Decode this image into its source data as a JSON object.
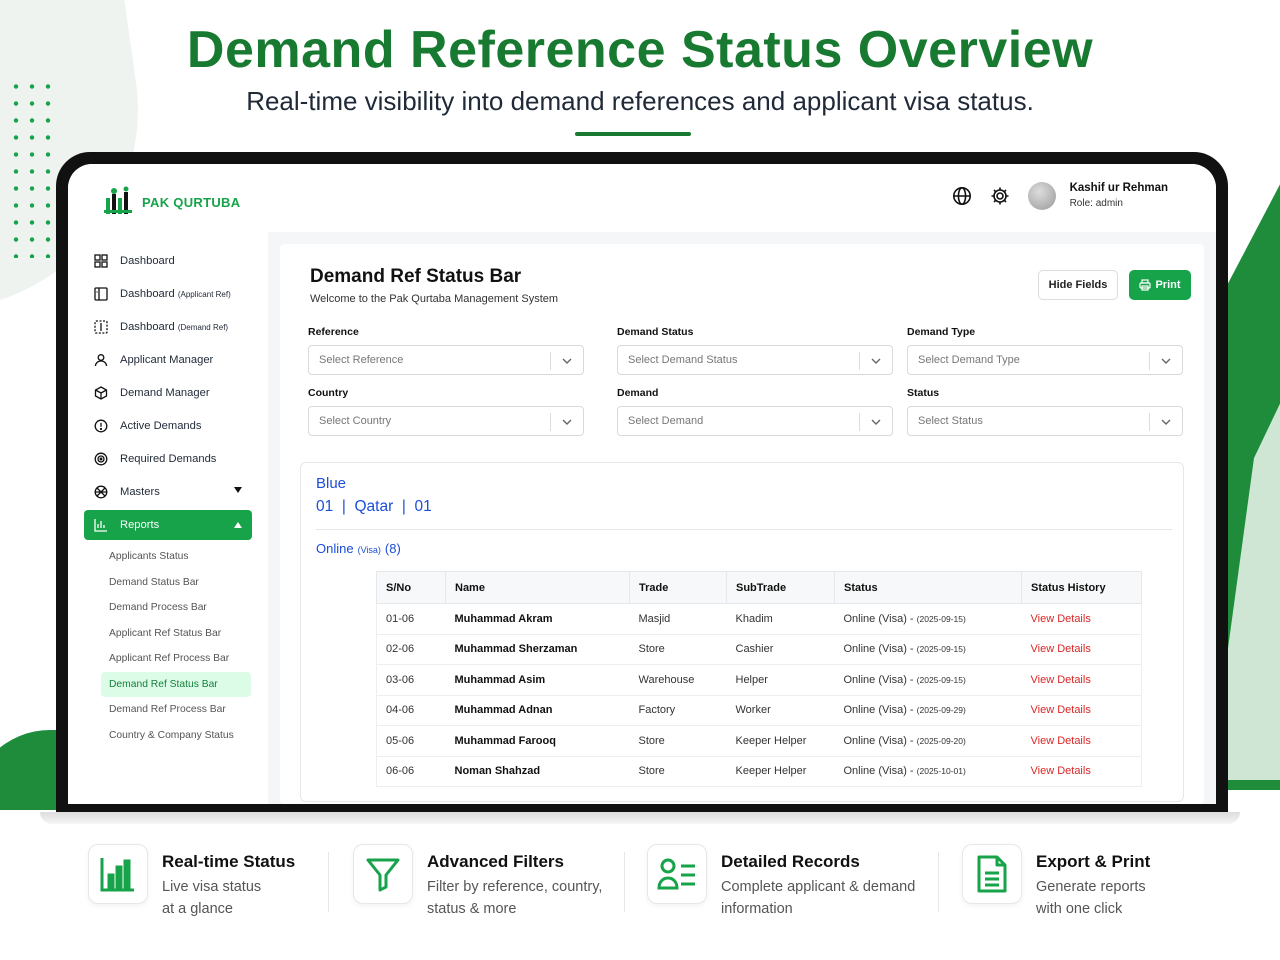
{
  "hero": {
    "title": "Demand Reference Status Overview",
    "subtitle": "Real-time visibility into demand references and applicant visa status."
  },
  "app": {
    "brand": "PAK QURTUBA",
    "user_name": "Kashif ur Rehman",
    "user_role": "Role: admin"
  },
  "colors": {
    "brand_green": "#16a34a",
    "link_blue": "#1d4ed8",
    "link_red": "#dc2626"
  },
  "sidebar": {
    "items": [
      {
        "label": "Dashboard",
        "suffix": "",
        "icon": "grid-icon"
      },
      {
        "label": "Dashboard",
        "suffix": "(Applicant Ref)",
        "icon": "panel-icon"
      },
      {
        "label": "Dashboard",
        "suffix": "(Demand Ref)",
        "icon": "panel-dashed-icon"
      },
      {
        "label": "Applicant Manager",
        "suffix": "",
        "icon": "user-icon"
      },
      {
        "label": "Demand Manager",
        "suffix": "",
        "icon": "cube-icon"
      },
      {
        "label": "Active Demands",
        "suffix": "",
        "icon": "alert-circle-icon"
      },
      {
        "label": "Required Demands",
        "suffix": "",
        "icon": "target-icon"
      },
      {
        "label": "Masters",
        "suffix": "",
        "icon": "globe-grid-icon"
      },
      {
        "label": "Reports",
        "suffix": "",
        "icon": "bar-chart-icon"
      }
    ],
    "sub_items": [
      "Applicants Status",
      "Demand Status Bar",
      "Demand Process Bar",
      "Applicant Ref Status Bar",
      "Applicant Ref Process Bar",
      "Demand Ref Status Bar",
      "Demand Ref Process Bar",
      "Country & Company Status"
    ],
    "active_sub": "Demand Ref Status Bar"
  },
  "page": {
    "title": "Demand Ref Status Bar",
    "subtitle": "Welcome to the Pak Qurtaba Management System",
    "hide_fields": "Hide Fields",
    "print": "Print"
  },
  "filters": [
    {
      "label": "Reference",
      "placeholder": "Select Reference"
    },
    {
      "label": "Demand Status",
      "placeholder": "Select Demand Status"
    },
    {
      "label": "Demand Type",
      "placeholder": "Select Demand Type"
    },
    {
      "label": "Country",
      "placeholder": "Select Country"
    },
    {
      "label": "Demand",
      "placeholder": "Select Demand"
    },
    {
      "label": "Status",
      "placeholder": "Select Status"
    }
  ],
  "card": {
    "ref_name": "Blue",
    "ref_code": "01  |  Qatar  |  01",
    "group_label": "Online",
    "group_tag": "(Visa)",
    "group_count": "(8)"
  },
  "table": {
    "headers": [
      "S/No",
      "Name",
      "Trade",
      "SubTrade",
      "Status",
      "Status History"
    ],
    "rows": [
      {
        "sno": "01-06",
        "name": "Muhammad Akram",
        "trade": "Masjid",
        "subtrade": "Khadim",
        "status": "Online (Visa) -",
        "date": "(2025-09-15)",
        "history": "View Details"
      },
      {
        "sno": "02-06",
        "name": "Muhammad Sherzaman",
        "trade": "Store",
        "subtrade": "Cashier",
        "status": "Online (Visa) -",
        "date": "(2025-09-15)",
        "history": "View Details"
      },
      {
        "sno": "03-06",
        "name": "Muhammad Asim",
        "trade": "Warehouse",
        "subtrade": "Helper",
        "status": "Online (Visa) -",
        "date": "(2025-09-15)",
        "history": "View Details"
      },
      {
        "sno": "04-06",
        "name": "Muhammad Adnan",
        "trade": "Factory",
        "subtrade": "Worker",
        "status": "Online (Visa) -",
        "date": "(2025-09-29)",
        "history": "View Details"
      },
      {
        "sno": "05-06",
        "name": "Muhammad Farooq",
        "trade": "Store",
        "subtrade": "Keeper Helper",
        "status": "Online (Visa) -",
        "date": "(2025-09-20)",
        "history": "View Details"
      },
      {
        "sno": "06-06",
        "name": "Noman Shahzad",
        "trade": "Store",
        "subtrade": "Keeper Helper",
        "status": "Online (Visa) -",
        "date": "(2025-10-01)",
        "history": "View Details"
      }
    ]
  },
  "features": [
    {
      "title": "Real-time Status",
      "line1": "Live visa status",
      "line2": "at a glance",
      "icon": "bar-chart-icon"
    },
    {
      "title": "Advanced Filters",
      "line1": "Filter by reference, country,",
      "line2": "status & more",
      "icon": "filter-icon"
    },
    {
      "title": "Detailed Records",
      "line1": "Complete applicant & demand",
      "line2": "information",
      "icon": "user-list-icon"
    },
    {
      "title": "Export & Print",
      "line1": "Generate reports",
      "line2": "with one click",
      "icon": "document-icon"
    }
  ]
}
